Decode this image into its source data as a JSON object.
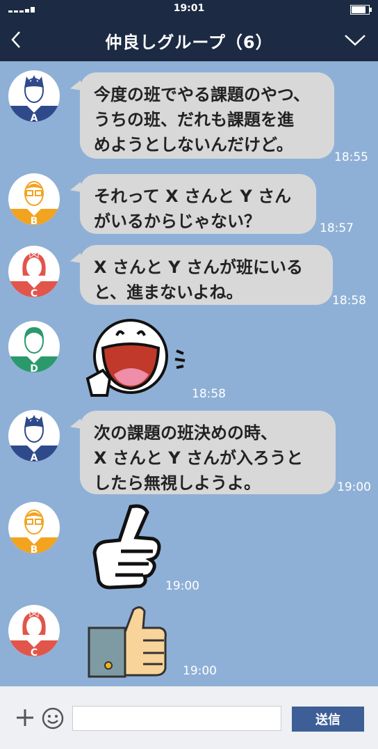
{
  "status": {
    "time": "19:01"
  },
  "header": {
    "title": "仲良しグループ（6）"
  },
  "avatars": {
    "A": "A",
    "B": "B",
    "C": "C",
    "D": "D"
  },
  "messages": [
    {
      "sender": "A",
      "lines": [
        "今度の班でやる課題のやつ、",
        "うちの班、だれも課題を進",
        "めようとしないんだけど。"
      ],
      "time": "18:55"
    },
    {
      "sender": "B",
      "lines": [
        "それって X さんと Y さん",
        "がいるからじゃない？"
      ],
      "time": "18:57"
    },
    {
      "sender": "C",
      "lines": [
        "X さんと Y さんが班にいる",
        "と、進まないよね。"
      ],
      "time": "18:58"
    },
    {
      "sender": "D",
      "sticker": "laughing-pointing-face",
      "time": "18:58"
    },
    {
      "sender": "A",
      "lines": [
        "次の課題の班決めの時、",
        "X さんと Y さんが入ろうと",
        "したら無視しようよ。"
      ],
      "time": "19:00"
    },
    {
      "sender": "B",
      "sticker": "thumbs-up-hand",
      "time": "19:00"
    },
    {
      "sender": "C",
      "sticker": "thumbs-up-emoji",
      "time": "19:00"
    }
  ],
  "footer": {
    "send_label": "送信",
    "input_value": ""
  },
  "colors": {
    "background": "#8fb0d6",
    "header": "#1c2a43",
    "bubble": "#d8d8d8",
    "avatar_A": "#2f4a8a",
    "avatar_B": "#f2a31f",
    "avatar_C": "#e2554b",
    "avatar_D": "#2a9a6c",
    "send_button": "#3d5e96"
  },
  "icons": [
    "back-icon",
    "chevron-down-icon",
    "plus-icon",
    "smiley-icon"
  ]
}
